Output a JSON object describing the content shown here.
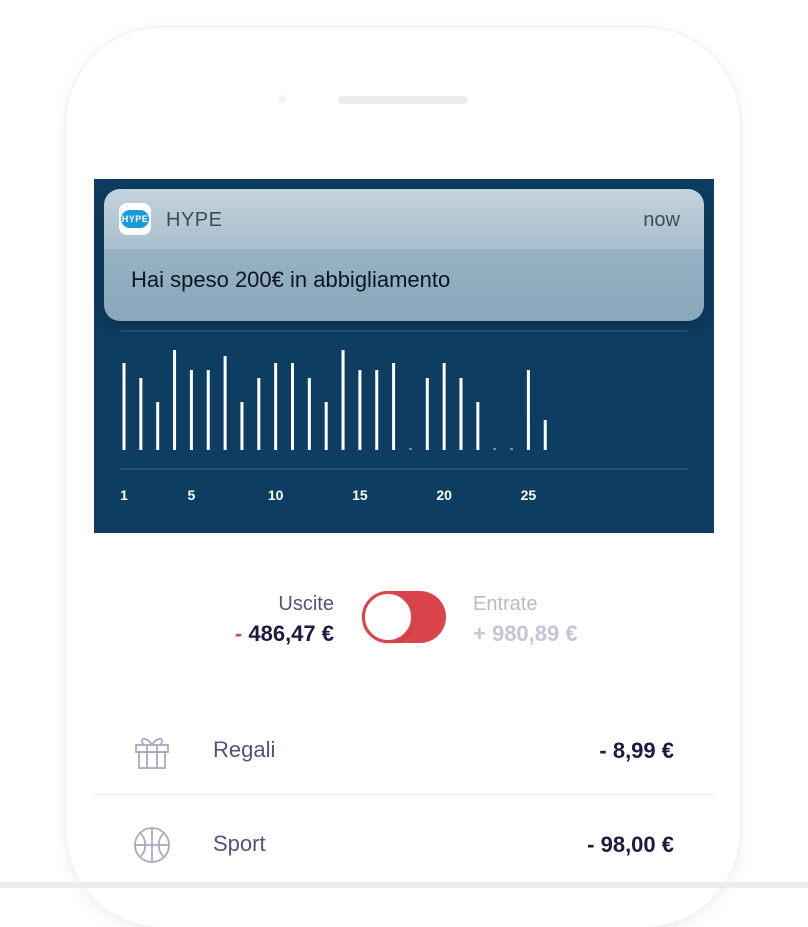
{
  "notification": {
    "app_name": "HYPE",
    "app_icon_text": "HYPE",
    "time": "now",
    "message": "Hai speso 200€ in abbigliamento"
  },
  "chart_data": {
    "type": "bar",
    "x": [
      1,
      2,
      3,
      4,
      5,
      6,
      7,
      8,
      9,
      10,
      11,
      12,
      13,
      14,
      15,
      16,
      17,
      18,
      19,
      20,
      21,
      22,
      23,
      24,
      25,
      26
    ],
    "values": [
      87,
      72,
      48,
      100,
      80,
      80,
      94,
      48,
      72,
      87,
      87,
      72,
      48,
      100,
      80,
      80,
      87,
      0,
      72,
      87,
      72,
      48,
      0,
      0,
      80,
      30
    ],
    "x_ticks": [
      "1",
      "5",
      "10",
      "15",
      "20",
      "25"
    ],
    "ylabel": "",
    "xlabel": "",
    "bar_color": "#ffffff",
    "background": "#0d3d61"
  },
  "summary": {
    "outgoing_label": "Uscite",
    "outgoing_sign": "-",
    "outgoing_amount": "486,47 €",
    "incoming_label": "Entrate",
    "incoming_amount": "+ 980,89 €",
    "toggle_state": "Uscite"
  },
  "categories": [
    {
      "icon": "gift-icon",
      "label": "Regali",
      "amount": "- 8,99 €"
    },
    {
      "icon": "basketball-icon",
      "label": "Sport",
      "amount": "- 98,00 €"
    }
  ],
  "colors": {
    "chart_bg": "#0d3d61",
    "accent_red": "#d9454a",
    "text_dark": "#1c1c3c",
    "text_muted": "#b9b9cc"
  }
}
